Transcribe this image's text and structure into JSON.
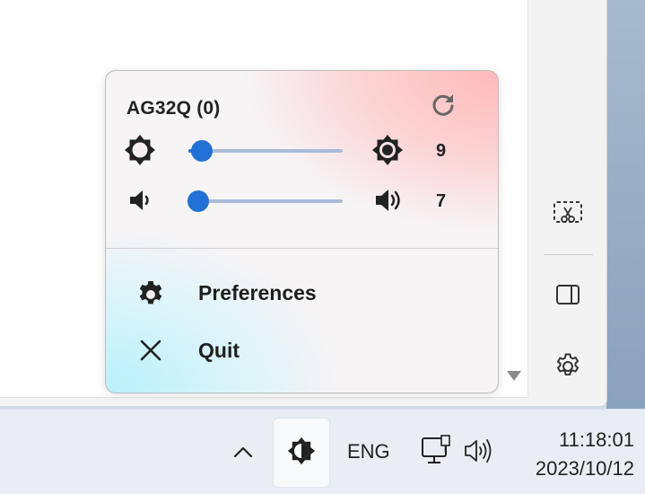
{
  "popup": {
    "monitor_name": "AG32Q (0)",
    "brightness": {
      "value": "9",
      "level_fraction": 0.09
    },
    "volume": {
      "value": "7",
      "level_fraction": 0.07
    },
    "menu": {
      "preferences_label": "Preferences",
      "quit_label": "Quit"
    },
    "icons": [
      "refresh-icon",
      "brightness-low-icon",
      "brightness-high-icon",
      "volume-low-icon",
      "volume-high-icon",
      "gear-icon",
      "close-icon"
    ]
  },
  "taskbar": {
    "language": "ENG",
    "time": "11:18:01",
    "date": "2023/10/12",
    "icons": [
      "chevron-up-icon",
      "monitor-brightness-icon",
      "network-icon",
      "speaker-icon"
    ]
  },
  "side_toolbar": {
    "icons": [
      "snipping-tool-icon",
      "panel-layout-icon",
      "settings-gear-icon"
    ]
  },
  "colors": {
    "accent": "#2271d6",
    "slider_track": "#a9bcd8",
    "popup_gradient_top_right": "#ffb9b9",
    "popup_gradient_bottom_left": "#b9f1fb"
  }
}
